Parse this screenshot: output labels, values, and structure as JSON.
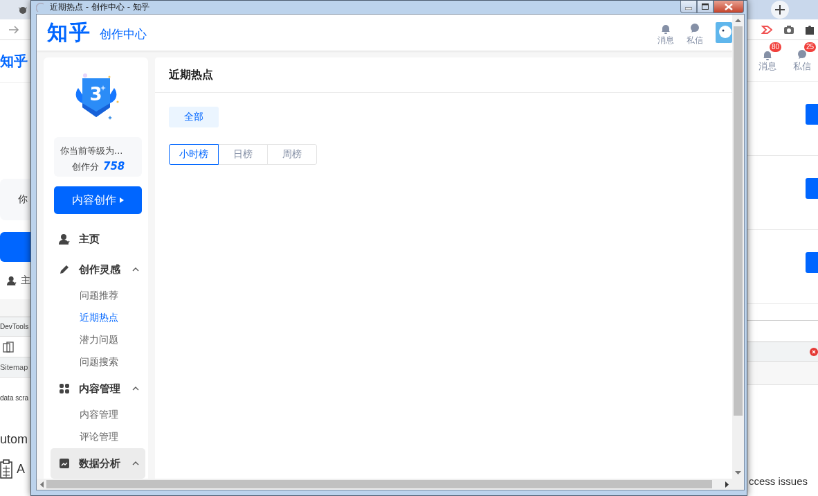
{
  "back_browser": {
    "logo": "知乎",
    "card_text": "你",
    "nav_text": "主",
    "devtools_tab": "DevTools",
    "panel_tab": "Sitemap",
    "snippet": "data scra",
    "heading": "utom",
    "list_text": "A",
    "notifications": [
      {
        "label": "消息",
        "count": "80"
      },
      {
        "label": "私信",
        "count": "25"
      }
    ],
    "issues_text": "ccess issues"
  },
  "popup_window": {
    "title": "近期热点 - 创作中心 - 知乎",
    "header": {
      "logo": "知乎",
      "subtitle": "创作中心",
      "actions": [
        {
          "label": "消息"
        },
        {
          "label": "私信"
        }
      ]
    },
    "sidebar": {
      "level_badge": "3",
      "level_card": {
        "text": "你当前等级为...",
        "score_label": "创作分",
        "score": "758"
      },
      "create_button": "内容创作",
      "nav": [
        {
          "label": "主页",
          "kind": "link",
          "hovered": false
        },
        {
          "label": "创作灵感",
          "kind": "group",
          "hovered": false,
          "expanded": true,
          "children": [
            {
              "label": "问题推荐",
              "selected": false
            },
            {
              "label": "近期热点",
              "selected": true
            },
            {
              "label": "潜力问题",
              "selected": false
            },
            {
              "label": "问题搜索",
              "selected": false
            }
          ]
        },
        {
          "label": "内容管理",
          "kind": "group",
          "hovered": false,
          "expanded": true,
          "children": [
            {
              "label": "内容管理",
              "selected": false
            },
            {
              "label": "评论管理",
              "selected": false
            }
          ]
        },
        {
          "label": "数据分析",
          "kind": "group",
          "hovered": true,
          "expanded": true
        }
      ]
    },
    "main": {
      "title": "近期热点",
      "filters": [
        {
          "label": "全部",
          "selected": true
        }
      ],
      "ranking_tabs": [
        {
          "label": "小时榜",
          "selected": true
        },
        {
          "label": "日榜",
          "selected": false
        },
        {
          "label": "周榜",
          "selected": false
        }
      ]
    }
  }
}
